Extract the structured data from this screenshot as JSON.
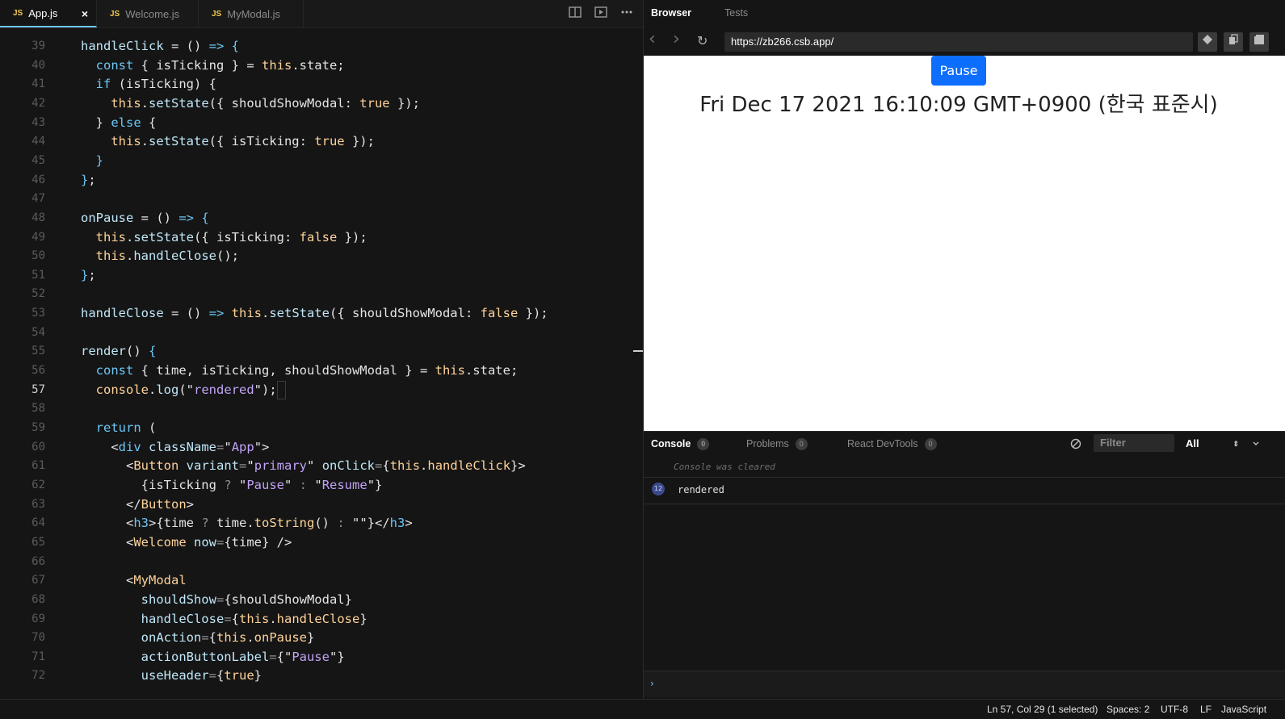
{
  "editor": {
    "tabs": [
      {
        "label": "App.js",
        "badge": "JS",
        "active": true
      },
      {
        "label": "Welcome.js",
        "badge": "JS",
        "active": false
      },
      {
        "label": "MyModal.js",
        "badge": "JS",
        "active": false
      }
    ],
    "tab_close_glyph": "×",
    "actions": [
      "split-icon",
      "preview-icon",
      "more-icon"
    ],
    "current_line": 57,
    "lines": [
      {
        "n": 39,
        "t": [
          [
            "fn",
            "handleClick"
          ],
          [
            "pl",
            " = () "
          ],
          [
            "kw",
            "=>"
          ],
          [
            "pl",
            " "
          ],
          [
            "kw",
            "{"
          ]
        ]
      },
      {
        "n": 40,
        "t": [
          [
            "pl",
            "  "
          ],
          [
            "kw",
            "const"
          ],
          [
            "pl",
            " { isTicking } = "
          ],
          [
            "this",
            "this"
          ],
          [
            "pl",
            ".state;"
          ]
        ]
      },
      {
        "n": 41,
        "t": [
          [
            "pl",
            "  "
          ],
          [
            "kw",
            "if"
          ],
          [
            "pl",
            " (isTicking) {"
          ]
        ]
      },
      {
        "n": 42,
        "t": [
          [
            "pl",
            "    "
          ],
          [
            "this",
            "this"
          ],
          [
            "pl",
            "."
          ],
          [
            "fn",
            "setState"
          ],
          [
            "pl",
            "({ shouldShowModal: "
          ],
          [
            "bool",
            "true"
          ],
          [
            "pl",
            " });"
          ]
        ]
      },
      {
        "n": 43,
        "t": [
          [
            "pl",
            "  } "
          ],
          [
            "kw",
            "else"
          ],
          [
            "pl",
            " {"
          ]
        ]
      },
      {
        "n": 44,
        "t": [
          [
            "pl",
            "    "
          ],
          [
            "this",
            "this"
          ],
          [
            "pl",
            "."
          ],
          [
            "fn",
            "setState"
          ],
          [
            "pl",
            "({ isTicking: "
          ],
          [
            "bool",
            "true"
          ],
          [
            "pl",
            " });"
          ]
        ]
      },
      {
        "n": 45,
        "t": [
          [
            "pl",
            "  "
          ],
          [
            "kw",
            "}"
          ]
        ]
      },
      {
        "n": 46,
        "t": [
          [
            "kw",
            "}"
          ],
          [
            "pl",
            ";"
          ]
        ]
      },
      {
        "n": 47,
        "t": []
      },
      {
        "n": 48,
        "t": [
          [
            "fn",
            "onPause"
          ],
          [
            "pl",
            " = () "
          ],
          [
            "kw",
            "=>"
          ],
          [
            "pl",
            " "
          ],
          [
            "kw",
            "{"
          ]
        ]
      },
      {
        "n": 49,
        "t": [
          [
            "pl",
            "  "
          ],
          [
            "this",
            "this"
          ],
          [
            "pl",
            "."
          ],
          [
            "fn",
            "setState"
          ],
          [
            "pl",
            "({ isTicking: "
          ],
          [
            "bool",
            "false"
          ],
          [
            "pl",
            " });"
          ]
        ]
      },
      {
        "n": 50,
        "t": [
          [
            "pl",
            "  "
          ],
          [
            "this",
            "this"
          ],
          [
            "pl",
            "."
          ],
          [
            "fn",
            "handleClose"
          ],
          [
            "pl",
            "();"
          ]
        ]
      },
      {
        "n": 51,
        "t": [
          [
            "kw",
            "}"
          ],
          [
            "pl",
            ";"
          ]
        ]
      },
      {
        "n": 52,
        "t": []
      },
      {
        "n": 53,
        "t": [
          [
            "fn",
            "handleClose"
          ],
          [
            "pl",
            " = () "
          ],
          [
            "kw",
            "=>"
          ],
          [
            "pl",
            " "
          ],
          [
            "this",
            "this"
          ],
          [
            "pl",
            "."
          ],
          [
            "fn",
            "setState"
          ],
          [
            "pl",
            "({ shouldShowModal: "
          ],
          [
            "bool",
            "false"
          ],
          [
            "pl",
            " });"
          ]
        ]
      },
      {
        "n": 54,
        "t": []
      },
      {
        "n": 55,
        "t": [
          [
            "fn",
            "render"
          ],
          [
            "pl",
            "() "
          ],
          [
            "kw",
            "{"
          ]
        ]
      },
      {
        "n": 56,
        "t": [
          [
            "pl",
            "  "
          ],
          [
            "kw",
            "const"
          ],
          [
            "pl",
            " { time, isTicking, shouldShowModal } = "
          ],
          [
            "this",
            "this"
          ],
          [
            "pl",
            ".state;"
          ]
        ]
      },
      {
        "n": 57,
        "t": [
          [
            "pl",
            "  "
          ],
          [
            "this",
            "console"
          ],
          [
            "pl",
            "."
          ],
          [
            "fn",
            "log"
          ],
          [
            "pl",
            "(\""
          ],
          [
            "str",
            "rendered"
          ],
          [
            "pl",
            "\");"
          ]
        ]
      },
      {
        "n": 58,
        "t": []
      },
      {
        "n": 59,
        "t": [
          [
            "pl",
            "  "
          ],
          [
            "kw",
            "return"
          ],
          [
            "pl",
            " ("
          ]
        ]
      },
      {
        "n": 60,
        "t": [
          [
            "pl",
            "    <"
          ],
          [
            "kw",
            "div"
          ],
          [
            "pl",
            " "
          ],
          [
            "attr",
            "className"
          ],
          [
            "op",
            "="
          ],
          [
            "pl",
            "\""
          ],
          [
            "str",
            "App"
          ],
          [
            "pl",
            "\">"
          ]
        ]
      },
      {
        "n": 61,
        "t": [
          [
            "pl",
            "      <"
          ],
          [
            "tag",
            "Button"
          ],
          [
            "pl",
            " "
          ],
          [
            "attr",
            "variant"
          ],
          [
            "op",
            "="
          ],
          [
            "pl",
            "\""
          ],
          [
            "str",
            "primary"
          ],
          [
            "pl",
            "\" "
          ],
          [
            "attr",
            "onClick"
          ],
          [
            "op",
            "="
          ],
          [
            "pl",
            "{"
          ],
          [
            "this",
            "this"
          ],
          [
            "pl",
            "."
          ],
          [
            "this",
            "handleClick"
          ],
          [
            "pl",
            "}>"
          ]
        ]
      },
      {
        "n": 62,
        "t": [
          [
            "pl",
            "        {isTicking "
          ],
          [
            "op",
            "?"
          ],
          [
            "pl",
            " \""
          ],
          [
            "str",
            "Pause"
          ],
          [
            "pl",
            "\" "
          ],
          [
            "op",
            ":"
          ],
          [
            "pl",
            " \""
          ],
          [
            "str",
            "Resume"
          ],
          [
            "pl",
            "\"}"
          ]
        ]
      },
      {
        "n": 63,
        "t": [
          [
            "pl",
            "      </"
          ],
          [
            "tag",
            "Button"
          ],
          [
            "pl",
            ">"
          ]
        ]
      },
      {
        "n": 64,
        "t": [
          [
            "pl",
            "      <"
          ],
          [
            "kw",
            "h3"
          ],
          [
            "pl",
            ">{time "
          ],
          [
            "op",
            "?"
          ],
          [
            "pl",
            " time."
          ],
          [
            "this",
            "toString"
          ],
          [
            "pl",
            "() "
          ],
          [
            "op",
            ":"
          ],
          [
            "pl",
            " \"\"}</"
          ],
          [
            "kw",
            "h3"
          ],
          [
            "pl",
            ">"
          ]
        ]
      },
      {
        "n": 65,
        "t": [
          [
            "pl",
            "      <"
          ],
          [
            "tag",
            "Welcome"
          ],
          [
            "pl",
            " "
          ],
          [
            "attr",
            "now"
          ],
          [
            "op",
            "="
          ],
          [
            "pl",
            "{time} />"
          ]
        ]
      },
      {
        "n": 66,
        "t": []
      },
      {
        "n": 67,
        "t": [
          [
            "pl",
            "      <"
          ],
          [
            "tag",
            "MyModal"
          ]
        ]
      },
      {
        "n": 68,
        "t": [
          [
            "pl",
            "        "
          ],
          [
            "attr",
            "shouldShow"
          ],
          [
            "op",
            "="
          ],
          [
            "pl",
            "{shouldShowModal}"
          ]
        ]
      },
      {
        "n": 69,
        "t": [
          [
            "pl",
            "        "
          ],
          [
            "attr",
            "handleClose"
          ],
          [
            "op",
            "="
          ],
          [
            "pl",
            "{"
          ],
          [
            "this",
            "this"
          ],
          [
            "pl",
            "."
          ],
          [
            "this",
            "handleClose"
          ],
          [
            "pl",
            "}"
          ]
        ]
      },
      {
        "n": 70,
        "t": [
          [
            "pl",
            "        "
          ],
          [
            "attr",
            "onAction"
          ],
          [
            "op",
            "="
          ],
          [
            "pl",
            "{"
          ],
          [
            "this",
            "this"
          ],
          [
            "pl",
            "."
          ],
          [
            "this",
            "onPause"
          ],
          [
            "pl",
            "}"
          ]
        ]
      },
      {
        "n": 71,
        "t": [
          [
            "pl",
            "        "
          ],
          [
            "attr",
            "actionButtonLabel"
          ],
          [
            "op",
            "="
          ],
          [
            "pl",
            "{\""
          ],
          [
            "str",
            "Pause"
          ],
          [
            "pl",
            "\"}"
          ]
        ]
      },
      {
        "n": 72,
        "t": [
          [
            "pl",
            "        "
          ],
          [
            "attr",
            "useHeader"
          ],
          [
            "op",
            "="
          ],
          [
            "pl",
            "{"
          ],
          [
            "bool",
            "true"
          ],
          [
            "pl",
            "}"
          ]
        ]
      }
    ]
  },
  "browser": {
    "tabs": [
      {
        "label": "Browser",
        "active": true
      },
      {
        "label": "Tests",
        "active": false
      }
    ],
    "nav": {
      "back": "‹",
      "forward": "›",
      "refresh": "↻"
    },
    "url": "https://zb266.csb.app/",
    "preview": {
      "button_label": "Pause",
      "clock_text": "Fri Dec 17 2021 16:10:09 GMT+0900 (한국 표준시)"
    }
  },
  "console": {
    "tabs": [
      {
        "label": "Console",
        "count": "0",
        "active": true
      },
      {
        "label": "Problems",
        "count": "0",
        "active": false
      },
      {
        "label": "React DevTools",
        "count": "0",
        "active": false
      }
    ],
    "filter_placeholder": "Filter",
    "level": "All",
    "cleared_msg": "Console was cleared",
    "logs": [
      {
        "count": "12",
        "text": "rendered"
      }
    ],
    "prompt": "›"
  },
  "status": {
    "cursor": "Ln 57, Col 29 (1 selected)",
    "spaces": "Spaces: 2",
    "encoding": "UTF-8",
    "eol": "LF",
    "language": "JavaScript"
  },
  "colors": {
    "accent": "#6cc7f6",
    "button_primary": "#0d6efd",
    "keyword": "#6cc7f6",
    "this": "#ffd399",
    "string": "#c1a3f6"
  }
}
